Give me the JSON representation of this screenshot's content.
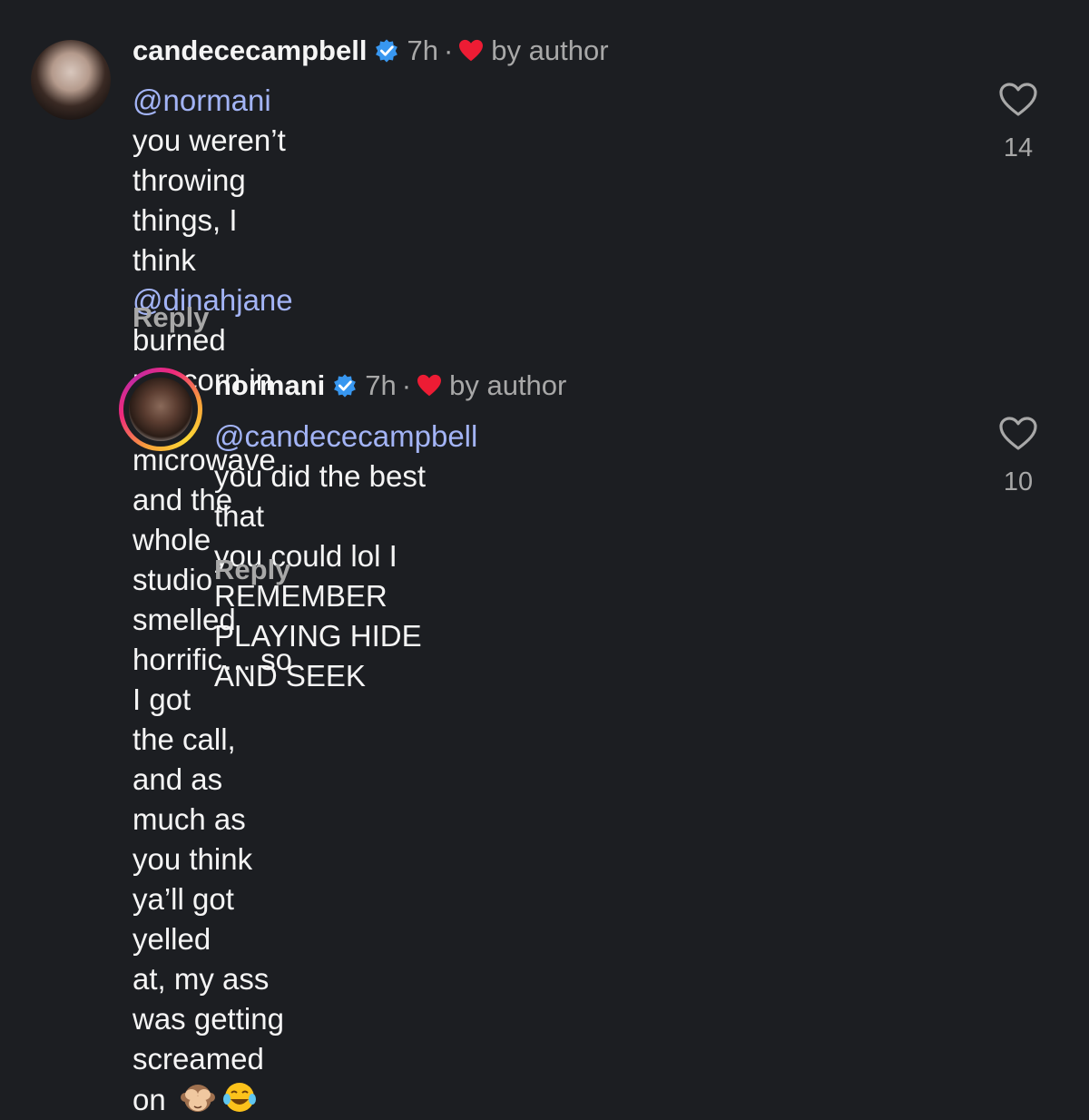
{
  "comments": [
    {
      "username": "candececampbell",
      "time": "7h",
      "separator": "·",
      "liked_by": "by author",
      "lines": [
        {
          "mention": "@normani",
          "text": " you weren’t throwing things, I think"
        },
        {
          "mention": "@dinahjane",
          "text": "  burned popcorn in the microwave"
        },
        {
          "mention": "",
          "text": "and the whole studio smelled horrific… so I got"
        },
        {
          "mention": "",
          "text": "the call, and as much as you think ya’ll got yelled"
        },
        {
          "mention": "",
          "text": "at, my ass was getting screamed on "
        }
      ],
      "emojis": [
        "see-no-evil-monkey",
        "tears-of-joy"
      ],
      "reply_label": "Reply",
      "like_count": "14"
    },
    {
      "username": "normani",
      "time": "7h",
      "separator": "·",
      "liked_by": "by author",
      "lines": [
        {
          "mention": "@candececampbell",
          "text": " you did the best that"
        },
        {
          "mention": "",
          "text": "you could lol I REMEMBER PLAYING HIDE"
        },
        {
          "mention": "",
          "text": "AND SEEK"
        }
      ],
      "reply_label": "Reply",
      "like_count": "10"
    }
  ],
  "colors": {
    "background": "#1c1e22",
    "mention": "#a3b4f6",
    "verified": "#3897f0",
    "heart": "#ed1c34",
    "muted": "#a8a8a8"
  }
}
